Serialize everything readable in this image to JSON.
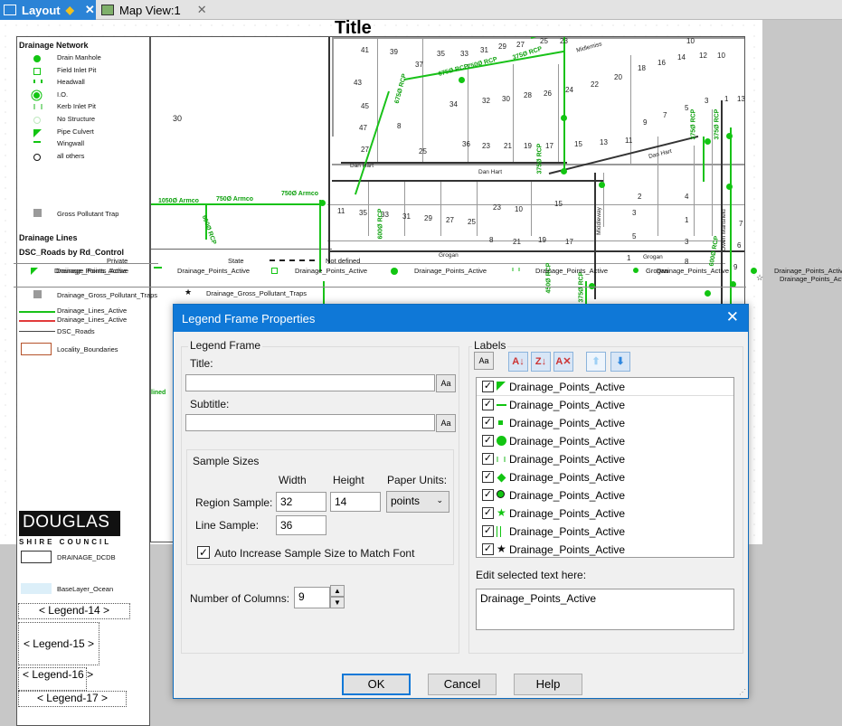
{
  "tabs": [
    {
      "label": "Layout",
      "icon": "layout-icon",
      "active": true
    },
    {
      "label": "Map View:1",
      "icon": "map-view-icon",
      "active": false
    }
  ],
  "page": {
    "title": "Title"
  },
  "legend": {
    "section1": "Drainage Network",
    "network_items": [
      "Drain Manhole",
      "Field Inlet Pit",
      "Headwall",
      "I.O.",
      "Kerb Inlet Pit",
      "No Structure",
      "Pipe Culvert",
      "Wingwall",
      "all others"
    ],
    "gross_pollutant": "Gross Pollutant Trap",
    "section2": "Drainage Lines",
    "section3": "DSC_Roads by Rd_Control",
    "lower_items": [
      "Drainage_Points_Active",
      "Drainage_Gross_Pollutant_Traps",
      "Drainage_Lines_Active",
      "Drainage_Lines_Active",
      "DSC_Roads",
      "Locality_Boundaries"
    ],
    "logo_main": "DOUGLAS",
    "logo_sub": "SHIRE COUNCIL",
    "dcdb": "DRAINAGE_DCDB",
    "ocean": "BaseLayer_Ocean",
    "placeholders": [
      "< Legend-14 >",
      "< Legend-15 >",
      "< Legend-16 >",
      "< Legend-17 >"
    ]
  },
  "map": {
    "margin_number": "30",
    "lots": [
      "41",
      "39",
      "37",
      "35",
      "33",
      "31",
      "29",
      "27",
      "25",
      "23",
      "43",
      "45",
      "47",
      "27",
      "25",
      "34",
      "32",
      "30",
      "28",
      "26",
      "24",
      "22",
      "20",
      "18",
      "16",
      "14",
      "12",
      "10",
      "8",
      "36",
      "23",
      "21",
      "19",
      "17",
      "15",
      "13",
      "11",
      "9",
      "7",
      "5",
      "3",
      "1",
      "13",
      "11",
      "35",
      "33",
      "31",
      "29",
      "27",
      "25",
      "23",
      "10",
      "8",
      "21",
      "19",
      "17",
      "15",
      "2",
      "4",
      "3",
      "1",
      "5",
      "3",
      "7",
      "6",
      "8",
      "9",
      "10",
      "1",
      "13"
    ],
    "roads": [
      "Dan Hart",
      "Dan Hart",
      "Dan Hart",
      "Grogan",
      "Grogan",
      "Middleway",
      "Owen Mansfield",
      "Midlemiss"
    ],
    "pipe_labels": [
      "1050Ø Armco",
      "750Ø Armco",
      "750Ø Armco",
      "600Ø RCP",
      "600Ø RCP",
      "675Ø RCP",
      "675Ø RCP",
      "750Ø RCP",
      "375Ø RCP",
      "375Ø RCP",
      "450Ø RCP",
      "375Ø RCP",
      "375Ø RCP",
      "600Ø RCP",
      "375Ø RCP"
    ],
    "lined_label": "lined",
    "strip_labels": [
      "Drainage_Points_Active",
      "Drainage_Points_Active",
      "Drainage_Points_Active",
      "Drainage_Points_Active",
      "Drainage_Points_Active",
      "Drainage_Points_Active",
      "Drainage_Points_Active",
      "Drainage_Points_Active",
      "Drainage_Points_Active"
    ],
    "strip_gross": "Drainage_Gross_Pollutant_Traps",
    "strip_misc": [
      "Private",
      "State",
      "Not defined",
      "Grogan"
    ]
  },
  "dialog": {
    "title": "Legend Frame Properties",
    "legend_frame_group": "Legend Frame",
    "title_label": "Title:",
    "title_value": "",
    "subtitle_label": "Subtitle:",
    "subtitle_value": "",
    "aa": "Aa",
    "sample_sizes_group": "Sample Sizes",
    "width_header": "Width",
    "height_header": "Height",
    "paper_units_header": "Paper Units:",
    "region_sample_label": "Region Sample:",
    "region_width": "32",
    "region_height": "14",
    "units_value": "points",
    "line_sample_label": "Line Sample:",
    "line_width": "36",
    "auto_increase_label": "Auto Increase Sample Size to Match Font",
    "auto_increase_checked": true,
    "columns_label": "Number of Columns:",
    "columns_value": "9",
    "labels_group": "Labels",
    "label_items": [
      {
        "text": "Drainage_Points_Active",
        "checked": true,
        "symbol": "pipe-culvert-symbol-icon"
      },
      {
        "text": "Drainage_Points_Active",
        "checked": true,
        "symbol": "wingwall-symbol-icon"
      },
      {
        "text": "Drainage_Points_Active",
        "checked": true,
        "symbol": "field-inlet-symbol-icon"
      },
      {
        "text": "Drainage_Points_Active",
        "checked": true,
        "symbol": "drain-manhole-symbol-icon"
      },
      {
        "text": "Drainage_Points_Active",
        "checked": true,
        "symbol": "kerb-inlet-symbol-icon"
      },
      {
        "text": "Drainage_Points_Active",
        "checked": true,
        "symbol": "io-symbol-icon"
      },
      {
        "text": "Drainage_Points_Active",
        "checked": true,
        "symbol": "all-others-symbol-icon"
      },
      {
        "text": "Drainage_Points_Active",
        "checked": true,
        "symbol": "green-star-symbol-icon"
      },
      {
        "text": "Drainage_Points_Active",
        "checked": true,
        "symbol": "headwall-symbol-icon"
      },
      {
        "text": "Drainage_Points_Active",
        "checked": true,
        "symbol": "black-star-symbol-icon"
      }
    ],
    "edit_label": "Edit selected text here:",
    "edit_value": "Drainage_Points_Active",
    "ok": "OK",
    "cancel": "Cancel",
    "help": "Help"
  },
  "colors": {
    "accent": "#0f78d7",
    "pipe": "#19c219",
    "tab_active": "#2b83d6"
  }
}
